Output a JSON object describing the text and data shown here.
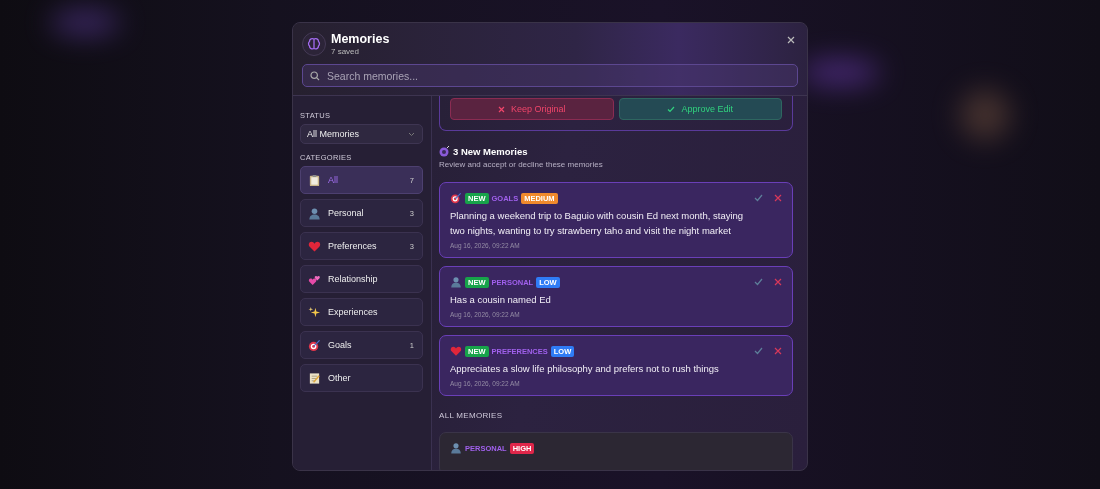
{
  "modal": {
    "title": "Memories",
    "subtitle": "7 saved",
    "search": {
      "placeholder": "Search memories..."
    }
  },
  "sidebar": {
    "status_label": "STATUS",
    "status_select": "All Memories",
    "categories_label": "CATEGORIES",
    "categories": [
      {
        "kind": "clipboard",
        "label": "All",
        "count": "7",
        "selected": true
      },
      {
        "kind": "person",
        "label": "Personal",
        "count": "3",
        "selected": false
      },
      {
        "kind": "heart",
        "label": "Preferences",
        "count": "3",
        "selected": false
      },
      {
        "kind": "hearts",
        "label": "Relationship",
        "selected": false
      },
      {
        "kind": "sparkles",
        "label": "Experiences",
        "selected": false
      },
      {
        "kind": "dart",
        "label": "Goals",
        "count": "1",
        "selected": false
      },
      {
        "kind": "memo",
        "label": "Other",
        "selected": false
      }
    ]
  },
  "pending_edit": {
    "buttons": [
      {
        "kind": "reject",
        "label": "Keep Original"
      },
      {
        "kind": "approve",
        "label": "Approve Edit"
      }
    ]
  },
  "new_memories": {
    "title": "3 New Memories",
    "subtitle": "Review and accept or decline these memories",
    "items": [
      {
        "kind": "dart",
        "badge": "NEW",
        "category": "GOALS",
        "priority": {
          "label": "MEDIUM",
          "color": "#f08a2c"
        },
        "text": "Planning a weekend trip to Baguio with cousin Ed next month, staying two nights, wanting to try strawberry taho and visit the night market",
        "date": "Aug 16, 2026, 09:22 AM"
      },
      {
        "kind": "person",
        "badge": "NEW",
        "category": "PERSONAL",
        "priority": {
          "label": "LOW",
          "color": "#2f7cf6"
        },
        "text": "Has a cousin named Ed",
        "date": "Aug 16, 2026, 09:22 AM"
      },
      {
        "kind": "heart",
        "badge": "NEW",
        "category": "PREFERENCES",
        "priority": {
          "label": "LOW",
          "color": "#2f7cf6"
        },
        "text": "Appreciates a slow life philosophy and prefers not to rush things",
        "date": "Aug 16, 2026, 09:22 AM"
      }
    ]
  },
  "all_memories": {
    "heading": "ALL MEMORIES",
    "items": [
      {
        "kind": "person",
        "category": "PERSONAL",
        "priority": {
          "label": "HIGH",
          "color": "#e0264a"
        }
      }
    ]
  }
}
